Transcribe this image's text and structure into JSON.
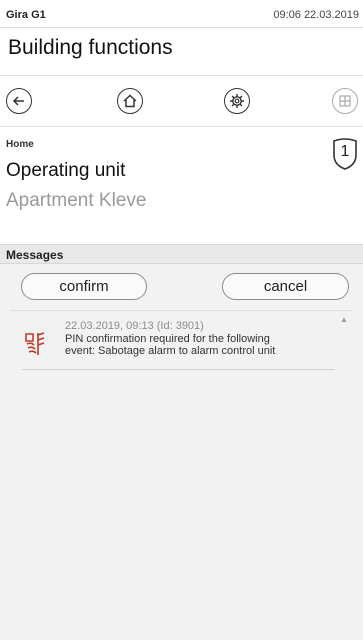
{
  "status": {
    "device": "Gira G1",
    "datetime": "09:06 22.03.2019"
  },
  "app": {
    "title": "Building functions"
  },
  "nav": {
    "back_icon": "back-arrow-icon",
    "home_icon": "home-icon",
    "settings_icon": "gear-icon",
    "grid_icon": "grid-icon"
  },
  "breadcrumb": "Home",
  "badge": "1",
  "page": {
    "title": "Operating unit",
    "subtitle": "Apartment Kleve"
  },
  "messages": {
    "header": "Messages",
    "confirm_label": "confirm",
    "cancel_label": "cancel",
    "items": [
      {
        "meta": "22.03.2019, 09:13 (Id: 3901)",
        "line1": "PIN confirmation required for the following",
        "line2": "event: Sabotage alarm to alarm control unit",
        "icon": "alarm-sabotage-icon",
        "icon_color": "#c0392b"
      }
    ]
  },
  "colors": {
    "accent_red": "#c0392b",
    "muted_text": "#9a9a9a"
  }
}
